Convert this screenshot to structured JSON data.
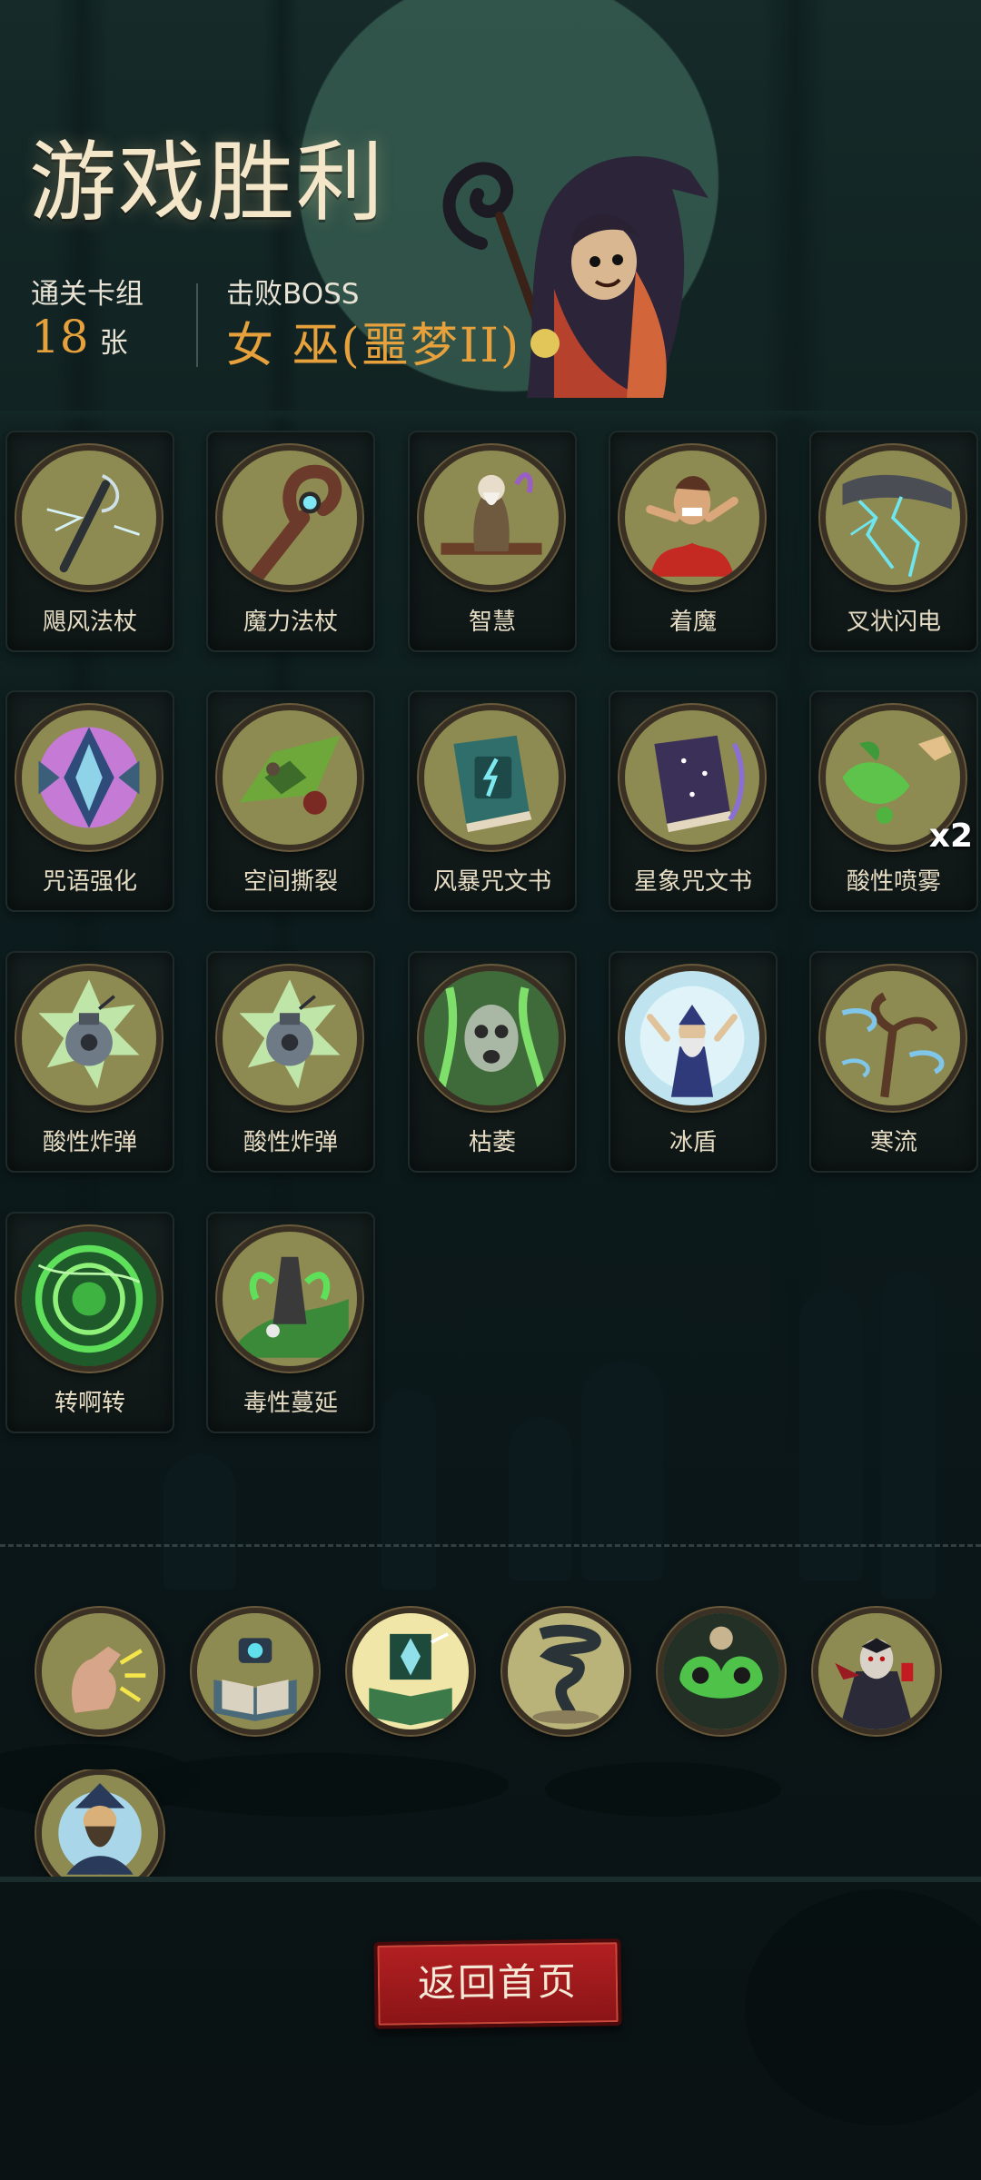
{
  "header": {
    "title": "游戏胜利",
    "deck_label": "通关卡组",
    "deck_count": "18",
    "deck_unit": "张",
    "boss_label": "击败BOSS",
    "boss_name": "女 巫(噩梦II)"
  },
  "cards": [
    {
      "name": "飓风法杖",
      "icon": "hurricane-staff-icon",
      "color": "#8d8a52"
    },
    {
      "name": "魔力法杖",
      "icon": "mana-staff-icon",
      "color": "#8d8a52"
    },
    {
      "name": "智慧",
      "icon": "wisdom-sage-icon",
      "color": "#8d8a52"
    },
    {
      "name": "着魔",
      "icon": "possessed-icon",
      "color": "#8d8a52"
    },
    {
      "name": "叉状闪电",
      "icon": "fork-lightning-icon",
      "color": "#8d8a52"
    },
    {
      "name": "咒语强化",
      "icon": "spell-boost-icon",
      "color": "#8d8a52"
    },
    {
      "name": "空间撕裂",
      "icon": "space-tear-icon",
      "color": "#8d8a52"
    },
    {
      "name": "风暴咒文书",
      "icon": "storm-spellbook-icon",
      "color": "#8d8a52"
    },
    {
      "name": "星象咒文书",
      "icon": "star-spellbook-icon",
      "color": "#8d8a52"
    },
    {
      "name": "酸性喷雾",
      "icon": "acid-spray-icon",
      "color": "#8d8a52",
      "multiplier": "x2"
    },
    {
      "name": "酸性炸弹",
      "icon": "acid-bomb-icon",
      "color": "#8d8a52"
    },
    {
      "name": "酸性炸弹",
      "icon": "acid-bomb-icon",
      "color": "#8d8a52"
    },
    {
      "name": "枯萎",
      "icon": "wither-icon",
      "color": "#8d8a52"
    },
    {
      "name": "冰盾",
      "icon": "ice-shield-icon",
      "color": "#8d8a52"
    },
    {
      "name": "寒流",
      "icon": "cold-wave-icon",
      "color": "#8d8a52"
    },
    {
      "name": "转啊转",
      "icon": "spin-vortex-icon",
      "color": "#8d8a52"
    },
    {
      "name": "毒性蔓延",
      "icon": "toxic-spread-icon",
      "color": "#8d8a52"
    }
  ],
  "relics": [
    {
      "icon": "finger-snap-icon"
    },
    {
      "icon": "open-spellbook-icon"
    },
    {
      "icon": "glowing-book-icon"
    },
    {
      "icon": "tornado-icon"
    },
    {
      "icon": "green-ghosts-icon"
    },
    {
      "icon": "vampire-icon"
    },
    {
      "icon": "old-wizard-icon"
    }
  ],
  "footer": {
    "home_button": "返回首页"
  },
  "colors": {
    "accent_gold": "#e6a13c",
    "title_cream": "#f4e6c8",
    "button_red": "#b32022",
    "icon_bg": "#8d8a52"
  }
}
